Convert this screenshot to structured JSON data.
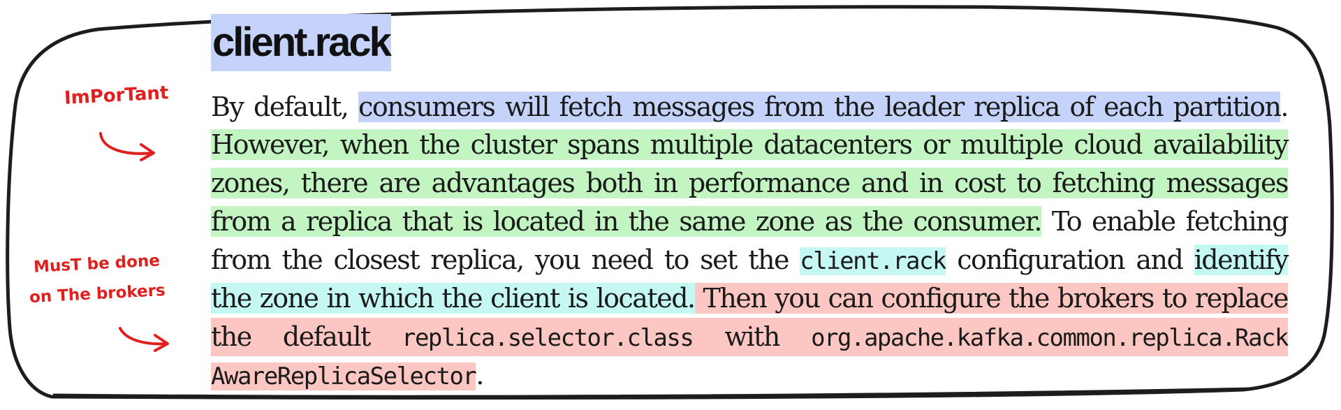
{
  "title": "client.rack",
  "annotations": {
    "important": "ImPorTant",
    "must_line1": "MusT be done",
    "must_line2": "on The brokers"
  },
  "paragraph": {
    "l1_a": "By default, ",
    "l1_b": "consumers will fetch messages from the leader replica of each partition",
    "l1_c": ".",
    "l2": "However, when the cluster spans multiple datacenters or multiple cloud availability",
    "l3": "zones, there are advantages both in performance and in cost to fetching messages",
    "l4_a": "from a replica that is located in the same zone as the consumer.",
    "l4_b": " To enable fetching",
    "l5_a": "from the closest replica, you need to set the ",
    "l5_code": "client.rack",
    "l5_b": " configuration and ",
    "l5_c": "identify",
    "l6_a": "the zone in which the client is located.",
    "l6_b": " Then you can configure the brokers to replace",
    "l7_a": "the default ",
    "l7_code1": "replica.selector.class",
    "l7_b": " with ",
    "l7_code2": "org.apache.kafka.common.replica.Rack",
    "l8_code": "AwareReplicaSelector",
    "l8_b": "."
  },
  "colors": {
    "highlight_blue": "#c5d3fb",
    "highlight_green": "#c3f5c3",
    "highlight_cyan": "#c5f7f3",
    "highlight_red": "#fcc6c2",
    "annotation_red": "#e0201e"
  }
}
